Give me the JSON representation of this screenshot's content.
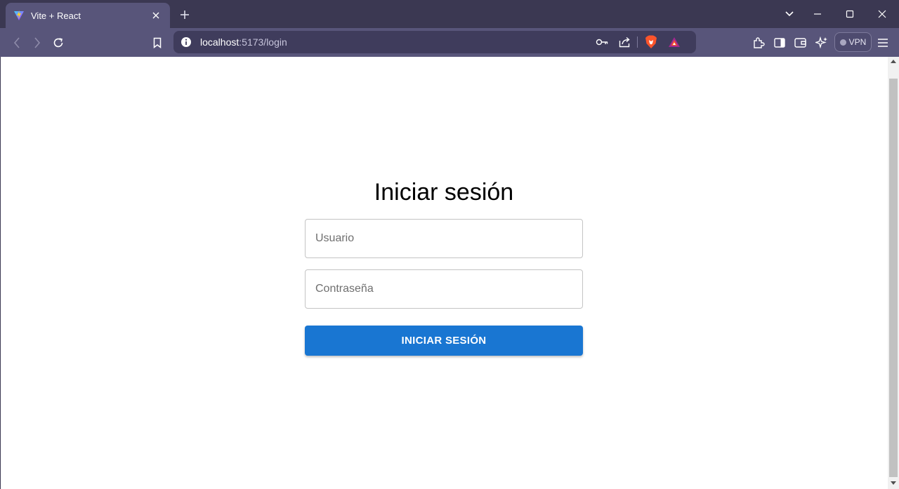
{
  "browser": {
    "tab_title": "Vite + React",
    "url_host": "localhost",
    "url_path": ":5173/login",
    "vpn_label": "VPN",
    "colors": {
      "tabbar": "#3b3852",
      "toolbar": "#58557a",
      "omnibox": "#3f3c5c"
    },
    "icons": [
      "vite-favicon",
      "close-icon",
      "plus-icon",
      "chevron-down-icon",
      "minimize-icon",
      "maximize-icon",
      "window-close-icon",
      "back-icon",
      "forward-icon",
      "reload-icon",
      "bookmark-icon",
      "info-icon",
      "key-icon",
      "share-icon",
      "brave-shields-icon",
      "brave-rewards-icon",
      "extensions-icon",
      "sidebar-icon",
      "wallet-icon",
      "leo-ai-icon",
      "menu-icon"
    ]
  },
  "login": {
    "title": "Iniciar sesión",
    "username_placeholder": "Usuario",
    "password_placeholder": "Contraseña",
    "submit_label": "INICIAR SESIÓN",
    "colors": {
      "button": "#1976d2",
      "button_text": "#ffffff",
      "field_border": "#c4c4c4"
    }
  }
}
